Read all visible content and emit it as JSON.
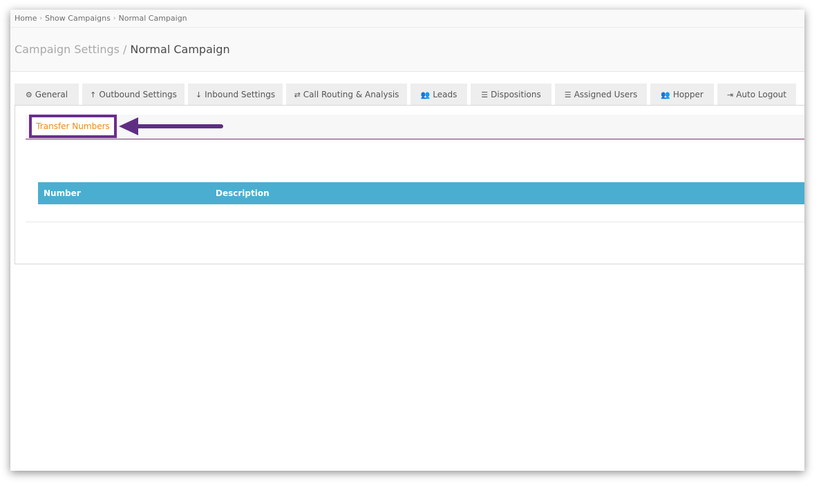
{
  "breadcrumb": {
    "items": [
      "Home",
      "Show Campaigns",
      "Normal Campaign"
    ],
    "separator": "›"
  },
  "header": {
    "section": "Campaign Settings",
    "separator": "/",
    "title": "Normal Campaign"
  },
  "tabs": [
    {
      "label": "General",
      "icon": "⚙",
      "icon_name": "cogs-icon"
    },
    {
      "label": "Outbound Settings",
      "icon": "↑",
      "icon_name": "arrow-up-icon"
    },
    {
      "label": "Inbound Settings",
      "icon": "↓",
      "icon_name": "arrow-down-icon"
    },
    {
      "label": "Call Routing & Analysis",
      "icon": "⇄",
      "icon_name": "shuffle-icon"
    },
    {
      "label": "Leads",
      "icon": "👥",
      "icon_name": "users-icon"
    },
    {
      "label": "Dispositions",
      "icon": "☰",
      "icon_name": "list-icon"
    },
    {
      "label": "Assigned Users",
      "icon": "☰",
      "icon_name": "list-ordered-icon"
    },
    {
      "label": "Hopper",
      "icon": "👥",
      "icon_name": "users-icon"
    },
    {
      "label": "Auto Logout",
      "icon": "⇥",
      "icon_name": "sign-out-icon"
    }
  ],
  "subtab": {
    "label": "Transfer Numbers"
  },
  "table": {
    "columns": [
      "Number",
      "Description"
    ],
    "rows": []
  },
  "colors": {
    "accent_orange": "#f08a10",
    "highlight_purple": "#6a2e8e",
    "table_header": "#4aaed0"
  }
}
